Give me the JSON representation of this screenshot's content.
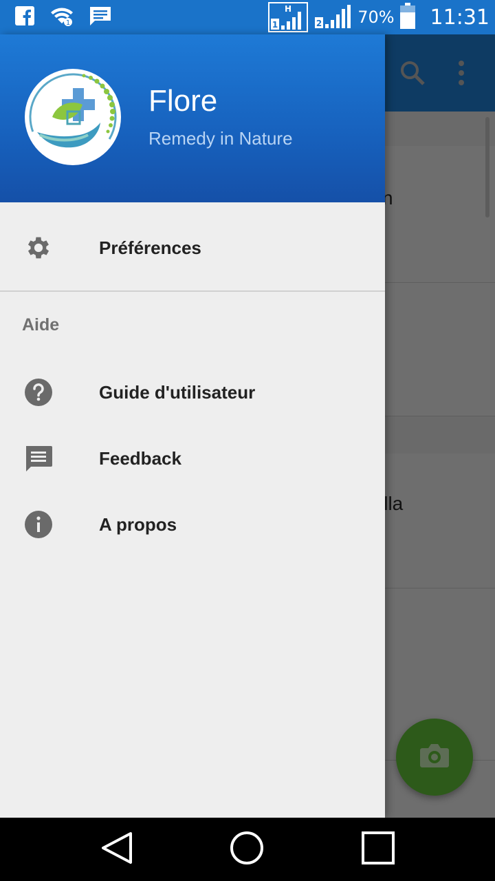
{
  "status_bar": {
    "battery": "70%",
    "time": "11:31",
    "icons": [
      "facebook-icon",
      "wifi-icon",
      "message-icon",
      "signal-sim1-icon",
      "signal-sim2-icon",
      "battery-icon"
    ],
    "sim1_network": "H",
    "sim1_label": "1",
    "sim2_label": "2"
  },
  "background": {
    "row_texts": [
      "n",
      "illa"
    ]
  },
  "drawer": {
    "app_name": "Flore",
    "tagline": "Remedy in Nature",
    "items": [
      {
        "label": "Préférences",
        "icon": "gear-icon"
      }
    ],
    "section_title": "Aide",
    "help_items": [
      {
        "label": "Guide d'utilisateur",
        "icon": "help-circle-icon"
      },
      {
        "label": "Feedback",
        "icon": "feedback-icon"
      },
      {
        "label": "A propos",
        "icon": "info-icon"
      }
    ]
  },
  "colors": {
    "header_blue": "#1a73c9",
    "fab_green": "#2d5a1a",
    "drawer_bg": "#eeeeee"
  }
}
